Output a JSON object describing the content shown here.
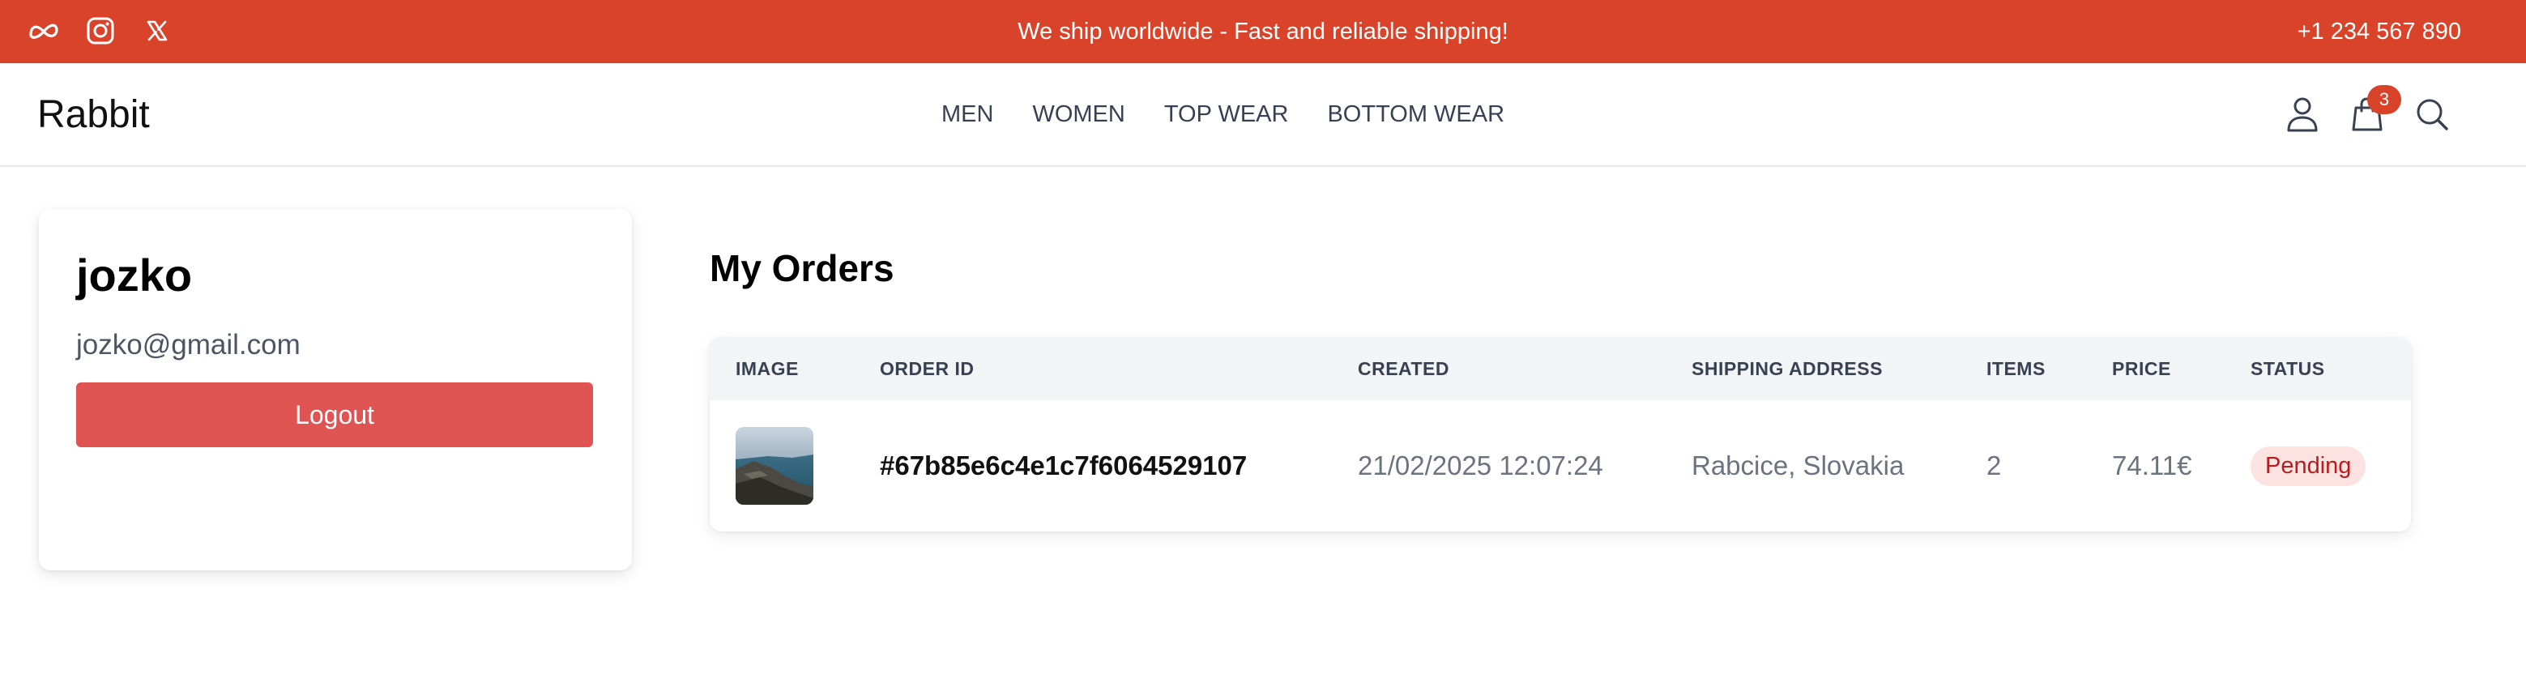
{
  "topbar": {
    "announcement": "We ship worldwide - Fast and reliable shipping!",
    "phone": "+1 234 567 890",
    "socials": [
      "meta-icon",
      "instagram-icon",
      "x-icon"
    ],
    "bg_color": "#d9432a"
  },
  "nav": {
    "logo": "Rabbit",
    "links": [
      "MEN",
      "WOMEN",
      "TOP WEAR",
      "BOTTOM WEAR"
    ],
    "cart_count": "3"
  },
  "profile": {
    "name": "jozko",
    "email": "jozko@gmail.com",
    "logout_label": "Logout"
  },
  "orders": {
    "title": "My Orders",
    "headers": [
      "IMAGE",
      "ORDER ID",
      "CREATED",
      "SHIPPING ADDRESS",
      "ITEMS",
      "PRICE",
      "STATUS"
    ],
    "rows": [
      {
        "order_id": "#67b85e6c4e1c7f6064529107",
        "created": "21/02/2025 12:07:24",
        "shipping_address": "Rabcice, Slovakia",
        "items": "2",
        "price": "74.11€",
        "status": "Pending"
      }
    ]
  }
}
